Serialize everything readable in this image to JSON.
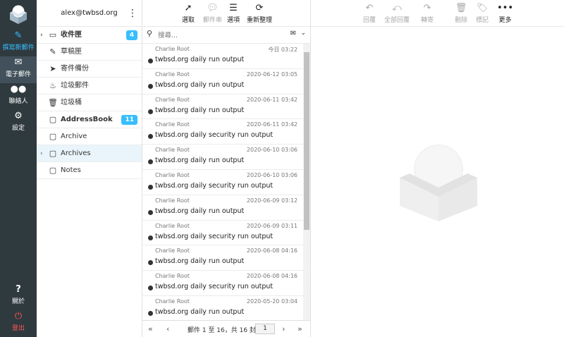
{
  "leftnav": {
    "compose": {
      "label": "撰寫新郵件",
      "icon": "compose-icon"
    },
    "mail": {
      "label": "電子郵件",
      "icon": "envelope-icon"
    },
    "contacts": {
      "label": "聯絡人",
      "icon": "users-icon"
    },
    "settings": {
      "label": "設定",
      "icon": "gear-icon"
    },
    "about": {
      "label": "關於",
      "icon": "question-icon"
    },
    "logout": {
      "label": "登出",
      "icon": "power-icon"
    }
  },
  "account": {
    "email": "alex@twbsd.org"
  },
  "folders": [
    {
      "label": "收件匣",
      "icon": "inbox-icon",
      "bold": true,
      "badge": "4",
      "arrow": true
    },
    {
      "label": "草稿匣",
      "icon": "pencil-icon"
    },
    {
      "label": "寄件備份",
      "icon": "send-icon"
    },
    {
      "label": "垃圾郵件",
      "icon": "flame-icon"
    },
    {
      "label": "垃圾桶",
      "icon": "trash-icon"
    },
    {
      "label": "AddressBook",
      "icon": "folder-icon",
      "bold": true,
      "badge": "11"
    },
    {
      "label": "Archive",
      "icon": "folder-icon"
    },
    {
      "label": "Archives",
      "icon": "folder-icon",
      "arrow": true,
      "selected": true
    },
    {
      "label": "Notes",
      "icon": "folder-icon"
    }
  ],
  "list_toolbar": {
    "select": "選取",
    "threads": "郵件串",
    "options": "選項",
    "refresh": "重新整理"
  },
  "search": {
    "placeholder": "搜尋..."
  },
  "messages": [
    {
      "from": "Charlie Root",
      "date": "今日 03:22",
      "subject": "twbsd.org daily run output"
    },
    {
      "from": "Charlie Root",
      "date": "2020-06-12 03:05",
      "subject": "twbsd.org daily run output"
    },
    {
      "from": "Charlie Root",
      "date": "2020-06-11 03:42",
      "subject": "twbsd.org daily run output"
    },
    {
      "from": "Charlie Root",
      "date": "2020-06-11 03:42",
      "subject": "twbsd.org daily security run output"
    },
    {
      "from": "Charlie Root",
      "date": "2020-06-10 03:06",
      "subject": "twbsd.org daily run output"
    },
    {
      "from": "Charlie Root",
      "date": "2020-06-10 03:06",
      "subject": "twbsd.org daily security run output"
    },
    {
      "from": "Charlie Root",
      "date": "2020-06-09 03:12",
      "subject": "twbsd.org daily run output"
    },
    {
      "from": "Charlie Root",
      "date": "2020-06-09 03:11",
      "subject": "twbsd.org daily security run output"
    },
    {
      "from": "Charlie Root",
      "date": "2020-06-08 04:16",
      "subject": "twbsd.org daily run output"
    },
    {
      "from": "Charlie Root",
      "date": "2020-06-08 04:16",
      "subject": "twbsd.org daily security run output"
    },
    {
      "from": "Charlie Root",
      "date": "2020-05-20 03:04",
      "subject": "twbsd.org daily run output"
    }
  ],
  "pager": {
    "text": "郵件 1 至 16，共 16 封",
    "page": "1"
  },
  "preview_toolbar": {
    "reply": "回覆",
    "reply_all": "全部回覆",
    "forward": "轉寄",
    "delete": "刪除",
    "mark": "標記",
    "more": "更多"
  },
  "colors": {
    "nav_bg": "#2f3a3f",
    "accent": "#37beff",
    "logout": "#ff5552",
    "selected_bg": "#eaf5fb"
  }
}
